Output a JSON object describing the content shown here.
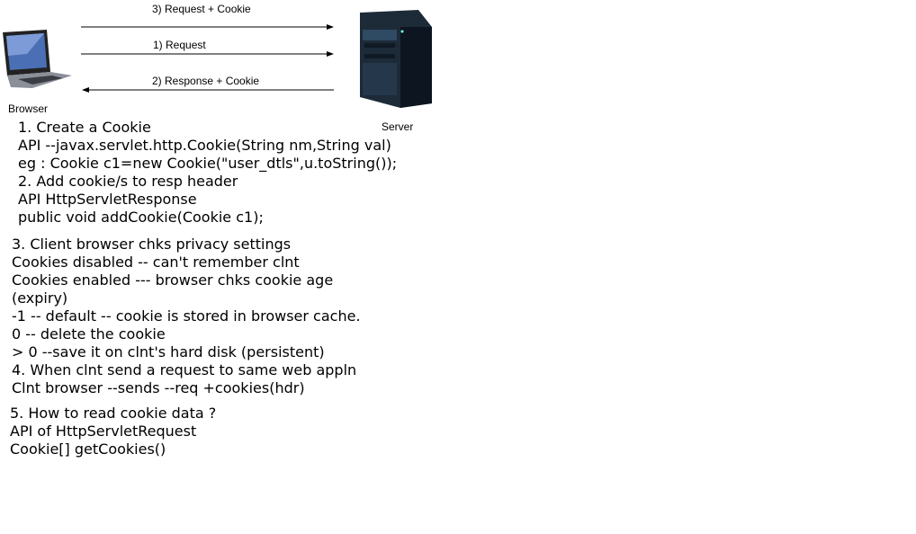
{
  "diagram": {
    "browser_label": "Browser",
    "server_label": "Server",
    "arrows": [
      {
        "label": "3) Request + Cookie",
        "direction": "to-server"
      },
      {
        "label": "1) Request",
        "direction": "to-server"
      },
      {
        "label": "2) Response + Cookie",
        "direction": "to-browser"
      }
    ]
  },
  "notes": {
    "block1": [
      "1. Create a Cookie",
      "API --javax.servlet.http.Cookie(String nm,String val)",
      "eg : Cookie c1=new Cookie(\"user_dtls\",u.toString());",
      "2. Add cookie/s to resp header",
      "API HttpServletResponse",
      "public void addCookie(Cookie c1);"
    ],
    "block2": [
      "3. Client browser chks privacy settings",
      "Cookies disabled -- can't remember clnt",
      "Cookies enabled --- browser chks cookie age",
      "(expiry)",
      "-1 -- default -- cookie is stored in browser cache.",
      "0 -- delete the cookie",
      "> 0 --save it on clnt's hard disk (persistent)",
      "4. When clnt send a request to same web appln",
      "Clnt browser --sends --req +cookies(hdr)"
    ],
    "block3": [
      "5. How to read cookie data ?",
      "API of HttpServletRequest",
      "Cookie[] getCookies()"
    ]
  }
}
